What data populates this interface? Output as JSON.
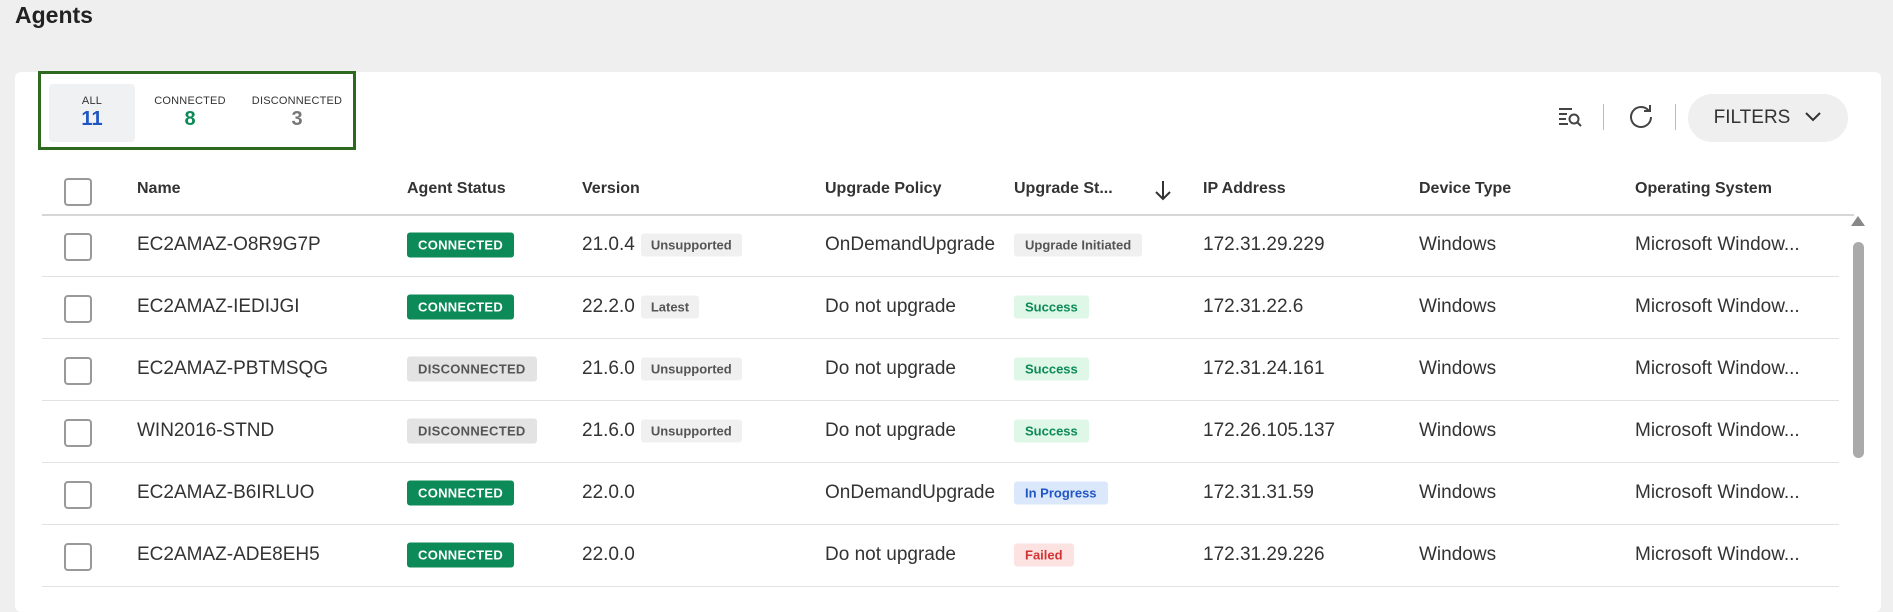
{
  "page": {
    "title": "Agents"
  },
  "tabs": [
    {
      "label": "ALL",
      "count": "11",
      "color": "#1f56c4"
    },
    {
      "label": "CONNECTED",
      "count": "8",
      "color": "#0c8a57"
    },
    {
      "label": "DISCONNECTED",
      "count": "3",
      "color": "#777777"
    }
  ],
  "toolbar": {
    "search_icon": "list-search-icon",
    "refresh_icon": "refresh-icon",
    "filters_label": "FILTERS"
  },
  "table": {
    "columns": [
      "Name",
      "Agent Status",
      "Version",
      "Upgrade Policy",
      "Upgrade St...",
      "IP Address",
      "Device Type",
      "Operating System"
    ],
    "rows": [
      {
        "name": "EC2AMAZ-O8R9G7P",
        "status": "CONNECTED",
        "version": "21.0.4",
        "version_tag": "Unsupported",
        "policy": "OnDemandUpgrade",
        "upgrade_status": "Upgrade Initiated",
        "ip": "172.31.29.229",
        "device": "Windows",
        "os": "Microsoft Window..."
      },
      {
        "name": "EC2AMAZ-IEDIJGI",
        "status": "CONNECTED",
        "version": "22.2.0",
        "version_tag": "Latest",
        "policy": "Do not upgrade",
        "upgrade_status": "Success",
        "ip": "172.31.22.6",
        "device": "Windows",
        "os": "Microsoft Window..."
      },
      {
        "name": "EC2AMAZ-PBTMSQG",
        "status": "DISCONNECTED",
        "version": "21.6.0",
        "version_tag": "Unsupported",
        "policy": "Do not upgrade",
        "upgrade_status": "Success",
        "ip": "172.31.24.161",
        "device": "Windows",
        "os": "Microsoft Window..."
      },
      {
        "name": "WIN2016-STND",
        "status": "DISCONNECTED",
        "version": "21.6.0",
        "version_tag": "Unsupported",
        "policy": "Do not upgrade",
        "upgrade_status": "Success",
        "ip": "172.26.105.137",
        "device": "Windows",
        "os": "Microsoft Window..."
      },
      {
        "name": "EC2AMAZ-B6IRLUO",
        "status": "CONNECTED",
        "version": "22.0.0",
        "version_tag": "",
        "policy": "OnDemandUpgrade",
        "upgrade_status": "In Progress",
        "ip": "172.31.31.59",
        "device": "Windows",
        "os": "Microsoft Window..."
      },
      {
        "name": "EC2AMAZ-ADE8EH5",
        "status": "CONNECTED",
        "version": "22.0.0",
        "version_tag": "",
        "policy": "Do not upgrade",
        "upgrade_status": "Failed",
        "ip": "172.31.29.226",
        "device": "Windows",
        "os": "Microsoft Window..."
      }
    ]
  },
  "colors": {
    "connected": "#0c8a57",
    "disconnected_bg": "#e3e3e3",
    "tab_highlight_border": "#2d6a1f"
  }
}
